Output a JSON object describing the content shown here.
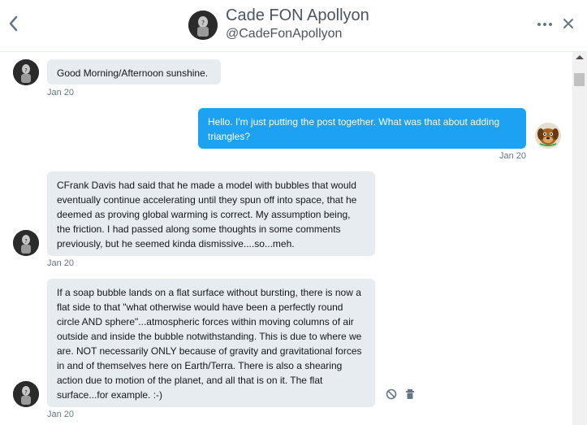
{
  "header": {
    "name": "Cade FON Apollyon",
    "handle": "@CadeFonApollyon"
  },
  "messages": [
    {
      "direction": "in",
      "text": "Good Morning/Afternoon sunshine.",
      "time": "Jan 20"
    },
    {
      "direction": "out",
      "text": "Hello. I'm just putting the post together. What was that about adding triangles?",
      "time": "Jan 20"
    },
    {
      "direction": "in",
      "text": "CFrank Davis had said that he made a model with bubbles that would eventually continue accelerating until they spun off into space, that he deemed as proving global warming is correct. My assumption being, the friction. I had passed along some thoughts in some comments previously, but he seemed kinda dismissive....so...meh.",
      "time": "Jan 20"
    },
    {
      "direction": "in",
      "text": "If a soap bubble lands on a flat surface without bursting, there is now a flat side to that \"what otherwise would have been a perfectly round circle AND sphere\"...atmospheric forces within moving columns of air outside and inside the bubble notwithstanding. This is due to where we are. NOT necessarily ONLY because of gravity and gravitational forces in and of themselves here on Earth/Terra. There is also a shearing action due to motion of the planet, and all that is on it. The flat surface...for example. :-)",
      "time": "Jan 20"
    }
  ],
  "icons": {
    "back": "chevron-left-icon",
    "more": "more-dots-icon",
    "close": "close-icon",
    "report": "block-icon",
    "delete": "trash-icon"
  },
  "colors": {
    "outgoing_bubble": "#1da1f2",
    "incoming_bubble": "#e6ecf0",
    "meta_text": "#657786"
  }
}
